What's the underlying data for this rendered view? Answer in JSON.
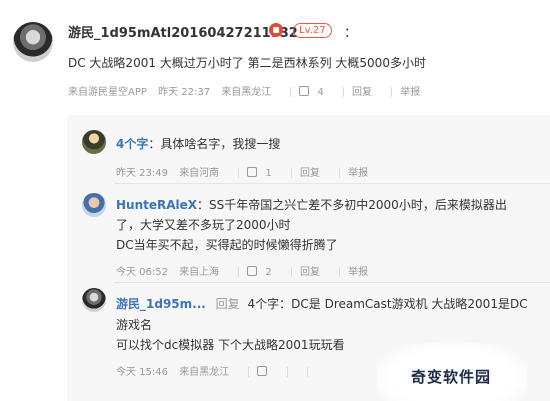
{
  "main_comment": {
    "username": "游民_1d95mAtl20160427211532",
    "level": "Lv.27",
    "colon": "：",
    "text": "DC 大战略2001  大概过万小时了  第二是西林系列  大概5000多小时",
    "source": "来自游民星空APP",
    "time": "昨天 22:37",
    "location": "来自黑龙江",
    "likes": "4",
    "reply_label": "回复",
    "report_label": "举报"
  },
  "replies": [
    {
      "username": "4个字",
      "text": "：具体啥名字，我搜一搜",
      "time": "昨天 23:49",
      "location": "来自河南",
      "likes": "1",
      "reply_label": "回复",
      "report_label": "举报"
    },
    {
      "username": "HunteRAleX",
      "text_line1": "：SS千年帝国之兴亡差不多初中2000小时，后来模拟器出",
      "text_line2": "了，大学又差不多玩了2000小时",
      "text_line3": "DC当年买不起，买得起的时候懒得折腾了",
      "time": "今天 06:52",
      "location": "来自上海",
      "likes": "2",
      "reply_label": "回复",
      "report_label": "举报"
    },
    {
      "username": "游民_1d95m...",
      "reply_to_label": "回复",
      "reply_to_user": "4个字",
      "text_line1": "：DC是 DreamCast游戏机  大战略2001是DC",
      "text_line2": "游戏名",
      "text_line3": "可以找个dc模拟器  下个大战略2001玩玩看",
      "time": "今天 15:46",
      "location": "来自黑龙江"
    }
  ],
  "watermark": {
    "text": "奇变软件园"
  }
}
